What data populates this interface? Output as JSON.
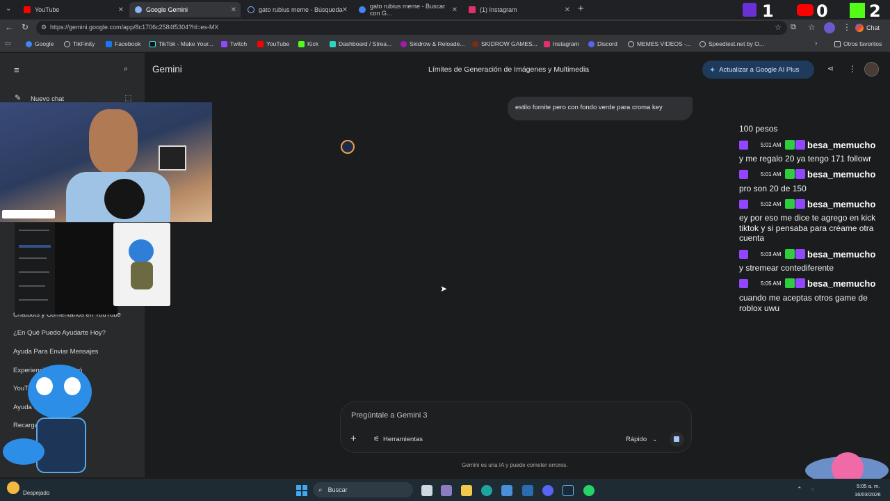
{
  "tabs": [
    {
      "label": "YouTube",
      "color": "#ff0000"
    },
    {
      "label": "Google Gemini",
      "color": "#8ab4f8"
    },
    {
      "label": "gato rubius meme - Búsqueda",
      "color": "#8ab4f8"
    },
    {
      "label": "gato rubius meme - Buscar con G...",
      "color": "#4285f4"
    },
    {
      "label": "(1) Instagram",
      "color": "#e1306c"
    }
  ],
  "scores": {
    "twitch": "1",
    "youtube": "0",
    "kick": "2"
  },
  "address": {
    "url": "https://gemini.google.com/app/8c1706c2584f5304?hl=es-MX"
  },
  "chrome_chat": "Chat",
  "bookmarks": [
    "Google",
    "TikFinity",
    "Facebook",
    "TikTok - Make Your...",
    "Twitch",
    "YouTube",
    "Kick",
    "Dashboard / Strea...",
    "Skidrow & Reloade...",
    "SKIDROW GAMES...",
    "Instagram",
    "Discord",
    "MEMES VIDEOS -...",
    "Speedtest.net by O..."
  ],
  "other_favorites": "Otros favoritos",
  "gemini": {
    "brand": "Gemini",
    "conversation_title": "Límites de Generación de Imágenes y Multimedia",
    "upgrade_button": "Actualizar a Google AI Plus",
    "new_chat": "Nuevo chat",
    "user_message": "estilo fornite pero con fondo verde para croma key",
    "sidebar_items": [
      "Chatbots y Comentarios en YouTube",
      "¿En Qué Puedo Ayudarte Hoy?",
      "Ayuda Para Enviar Mensajes",
      "Experiencia Que Marcó",
      "YouTube Capabilities",
      "Ayuda Gemini",
      "Recarga Tu Celular"
    ],
    "input_placeholder": "Pregúntale a Gemini 3",
    "tools_label": "Herramientas",
    "mode_label": "Rápido",
    "disclaimer": "Gemini es una IA y puede cometer errores."
  },
  "stream_chat": {
    "top_line": "100 pesos",
    "messages": [
      {
        "time": "5:01 AM",
        "user": "besa_memucho",
        "text": "y me regalo 20 ya tengo 171 followr"
      },
      {
        "time": "5:01 AM",
        "user": "besa_memucho",
        "text": "pro son 20 de 150"
      },
      {
        "time": "5:02 AM",
        "user": "besa_memucho",
        "text": "ey por eso me dice te agrego en kick tiktok y si pensaba para créame otra cuenta"
      },
      {
        "time": "5:03 AM",
        "user": "besa_memucho",
        "text": "y stremear contediferente"
      },
      {
        "time": "5:05 AM",
        "user": "besa_memucho",
        "text": "cuando me aceptas otros game de roblox uwu"
      }
    ]
  },
  "taskbar": {
    "weather": "Despejado",
    "search": "Buscar",
    "time": "5:05 a. m.",
    "date": "16/03/2026"
  }
}
